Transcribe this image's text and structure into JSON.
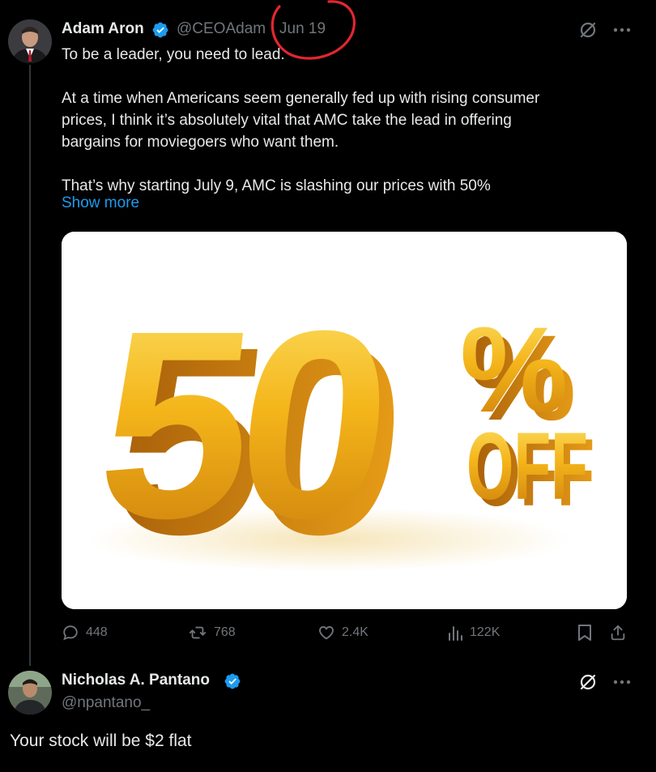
{
  "tweet": {
    "author_name": "Adam Aron",
    "handle": "@CEOAdam",
    "separator": "·",
    "date": "Jun 19",
    "text_lines": [
      "To be a leader, you need to lead.",
      "",
      "At a time when Americans seem generally fed up with rising consumer",
      "prices, I think it’s absolutely vital that AMC take the lead in offering",
      "bargains for moviegoers who want them.",
      "",
      "That’s why starting July 9, AMC is slashing our prices with 50%"
    ],
    "show_more": "Show more",
    "image": {
      "big_text": "50",
      "percent": "%",
      "off": "OFF"
    },
    "actions": {
      "replies": "448",
      "reposts": "768",
      "likes": "2.4K",
      "views": "122K"
    }
  },
  "reply": {
    "author_name": "Nicholas A. Pantano",
    "handle": "@npantano_",
    "text": "Your stock will be $2 flat"
  },
  "icons": {
    "verified": "verified-badge-icon",
    "grok": "grok-icon",
    "more": "more-icon",
    "reply": "reply-icon",
    "repost": "repost-icon",
    "like": "like-icon",
    "views": "views-icon",
    "bookmark": "bookmark-icon",
    "share": "share-icon"
  },
  "colors": {
    "background": "#000000",
    "text": "#e7e9ea",
    "muted": "#71767b",
    "link": "#1d9bf0",
    "verified": "#1d9bf0",
    "annotation": "#e3262f",
    "gold": "#f2b418"
  }
}
